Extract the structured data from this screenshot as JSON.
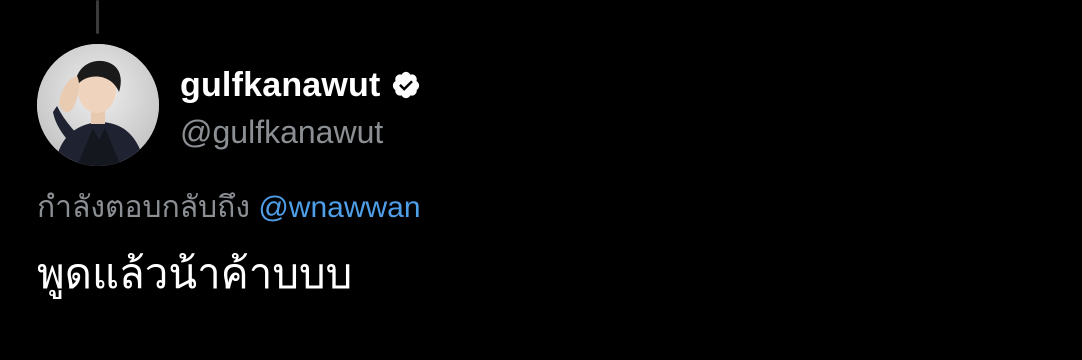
{
  "tweet": {
    "author": {
      "display_name": "gulfkanawut",
      "handle": "@gulfkanawut",
      "verified": true,
      "avatar_icon": "profile-photo"
    },
    "reply_prefix": "กำลังตอบกลับถึง",
    "reply_mention": "@wnawwan",
    "text": "พูดแล้วน้าค้าบบบ"
  },
  "colors": {
    "background": "#000000",
    "primary_text": "#ffffff",
    "secondary_text": "#8b8f94",
    "mention": "#4f9ee8",
    "verified_badge": "#ffffff"
  }
}
